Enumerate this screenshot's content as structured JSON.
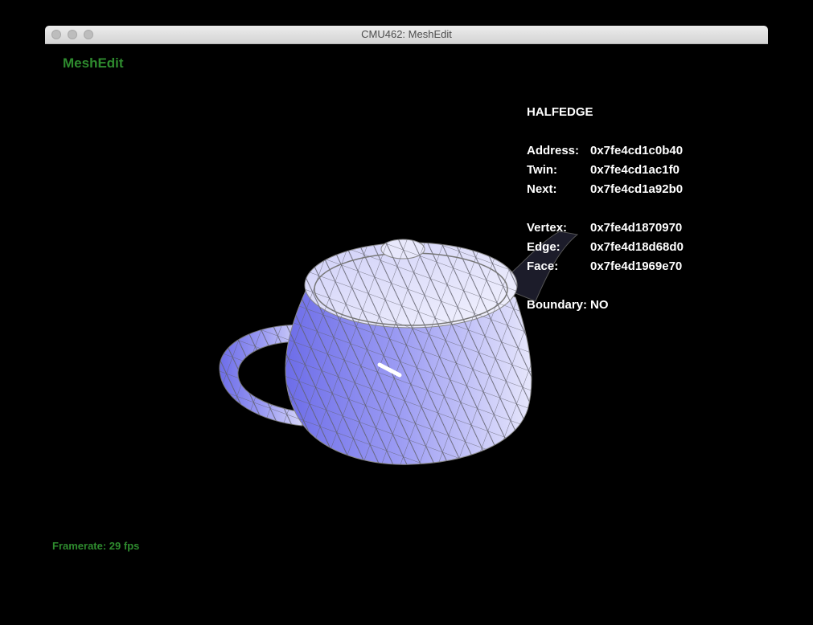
{
  "window": {
    "title": "CMU462: MeshEdit"
  },
  "app": {
    "name": "MeshEdit",
    "framerate": "Framerate: 29 fps"
  },
  "info": {
    "title": "HALFEDGE",
    "rows": [
      {
        "label": "Address:",
        "value": "0x7fe4cd1c0b40"
      },
      {
        "label": "Twin:",
        "value": "0x7fe4cd1ac1f0"
      },
      {
        "label": "Next:",
        "value": "0x7fe4cd1a92b0"
      },
      {
        "label": "Vertex:",
        "value": "0x7fe4d1870970"
      },
      {
        "label": "Edge:",
        "value": "0x7fe4d18d68d0"
      },
      {
        "label": "Face:",
        "value": "0x7fe4d1969e70"
      },
      {
        "label": "Boundary:",
        "value": "NO"
      }
    ]
  },
  "colors": {
    "accent": "#2e8b2e",
    "mesh_fill": "#a9a9f5",
    "mesh_shadow": "#7070e0",
    "wire": "#6e6e6e"
  },
  "icons": [
    "close-button",
    "minimize-button",
    "zoom-button"
  ]
}
